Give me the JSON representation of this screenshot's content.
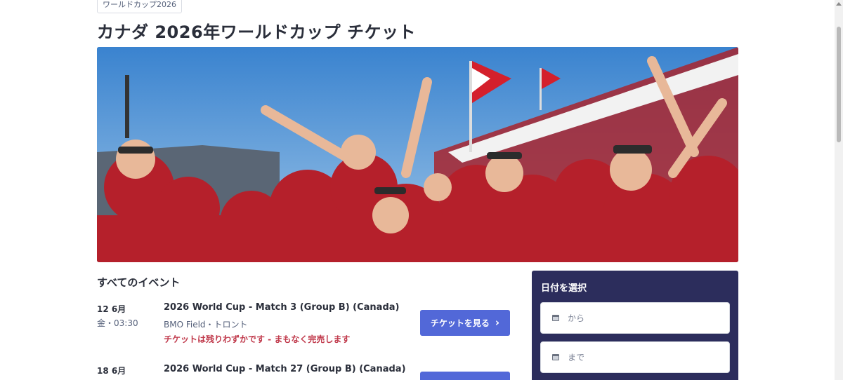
{
  "breadcrumb": {
    "tag": "ワールドカップ2026"
  },
  "page": {
    "title": "カナダ 2026年ワールドカップ チケット"
  },
  "hero": {
    "alt": "fans cheering"
  },
  "events": {
    "section_title": "すべてのイベント",
    "items": [
      {
        "date": "12 6月",
        "time": "金・03:30",
        "name": "2026 World Cup - Match 3 (Group B) (Canada)",
        "venue": "BMO Field・トロント",
        "warning": "チケットは残りわずかです - まもなく完売します",
        "button": "チケットを見る"
      },
      {
        "date": "18 6月",
        "time": "",
        "name": "2026 World Cup - Match 27 (Group B) (Canada)",
        "venue": "",
        "warning": "",
        "button": ""
      }
    ]
  },
  "date_filter": {
    "title": "日付を選択",
    "from_placeholder": "から",
    "to_placeholder": "まで"
  },
  "colors": {
    "accent": "#5268d8",
    "panel": "#2c2d5c",
    "warning": "#c0394b"
  }
}
